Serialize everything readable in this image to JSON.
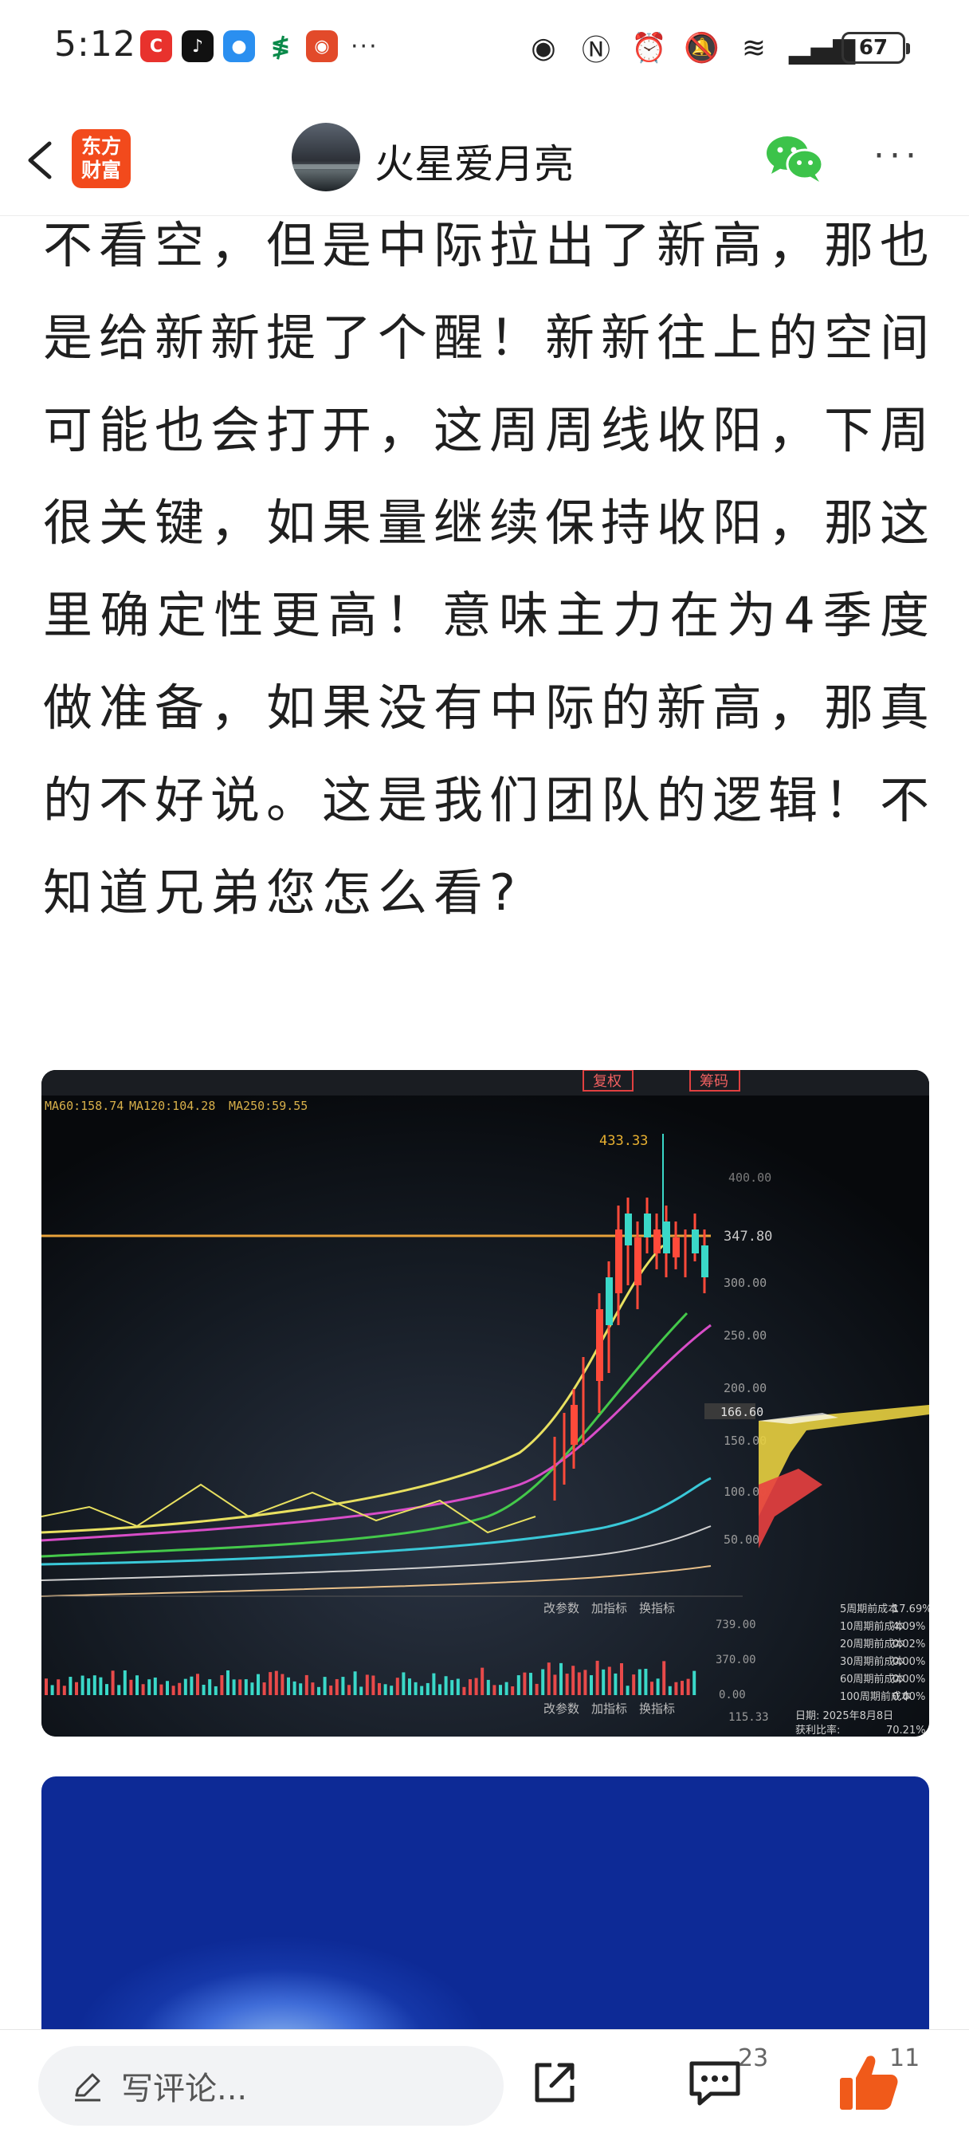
{
  "status_bar": {
    "time": "5:12",
    "app_icons": [
      "c-icon",
      "tiktok-icon",
      "message-bubble-icon",
      "bank-icon",
      "app-red-icon"
    ],
    "more": "···",
    "battery": "67"
  },
  "header": {
    "brand_logo_line1": "东方",
    "brand_logo_line2": "财富",
    "username": "火星爱月亮",
    "more": "···"
  },
  "article": {
    "text": "不看空，但是中际拉出了新高，那也是给新新提了个醒！新新往上的空间可能也会打开，这周周线收阳，下周很关键，如果量继续保持收阳，那这里确定性更高！意味主力在为4季度做准备，如果没有中际的新高，那真的不好说。这是我们团队的逻辑！不知道兄弟您怎么看?"
  },
  "photo": {
    "ma_legend": [
      "MA60:158.74",
      "MA120:104.28",
      "MA250:59.55"
    ],
    "top_buttons": [
      "复权",
      "筹码"
    ],
    "peak_label": "433.33",
    "price_label": "347.80",
    "current_price": "166.60",
    "y_ticks": [
      "400.00",
      "300.00",
      "250.00",
      "200.00",
      "150.00",
      "100.00",
      "50.00"
    ],
    "sub_menu": [
      "改参数",
      "加指标",
      "换指标"
    ],
    "volume_ticks": [
      "739.00",
      "370.00",
      "0.00"
    ],
    "bottom_value": "115.33",
    "cost_legend": [
      {
        "label": "5周期前成本",
        "value": "17.69%"
      },
      {
        "label": "10周期前成本",
        "value": "4.09%"
      },
      {
        "label": "20周期前成本",
        "value": "0.02%"
      },
      {
        "label": "30周期前成本",
        "value": "0.00%"
      },
      {
        "label": "60周期前成本",
        "value": "0.00%"
      },
      {
        "label": "100周期前成本",
        "value": "0.00%"
      }
    ],
    "date_text": "日期: 2025年8月8日",
    "profit_text": "获利比率:",
    "profit_value": "70.21%"
  },
  "bottom_bar": {
    "comment_placeholder": "写评论...",
    "comment_count": "23",
    "like_count": "11"
  },
  "colors": {
    "brand": "#f24a1c",
    "wechat": "#3cc34a",
    "like": "#f05a1a"
  }
}
